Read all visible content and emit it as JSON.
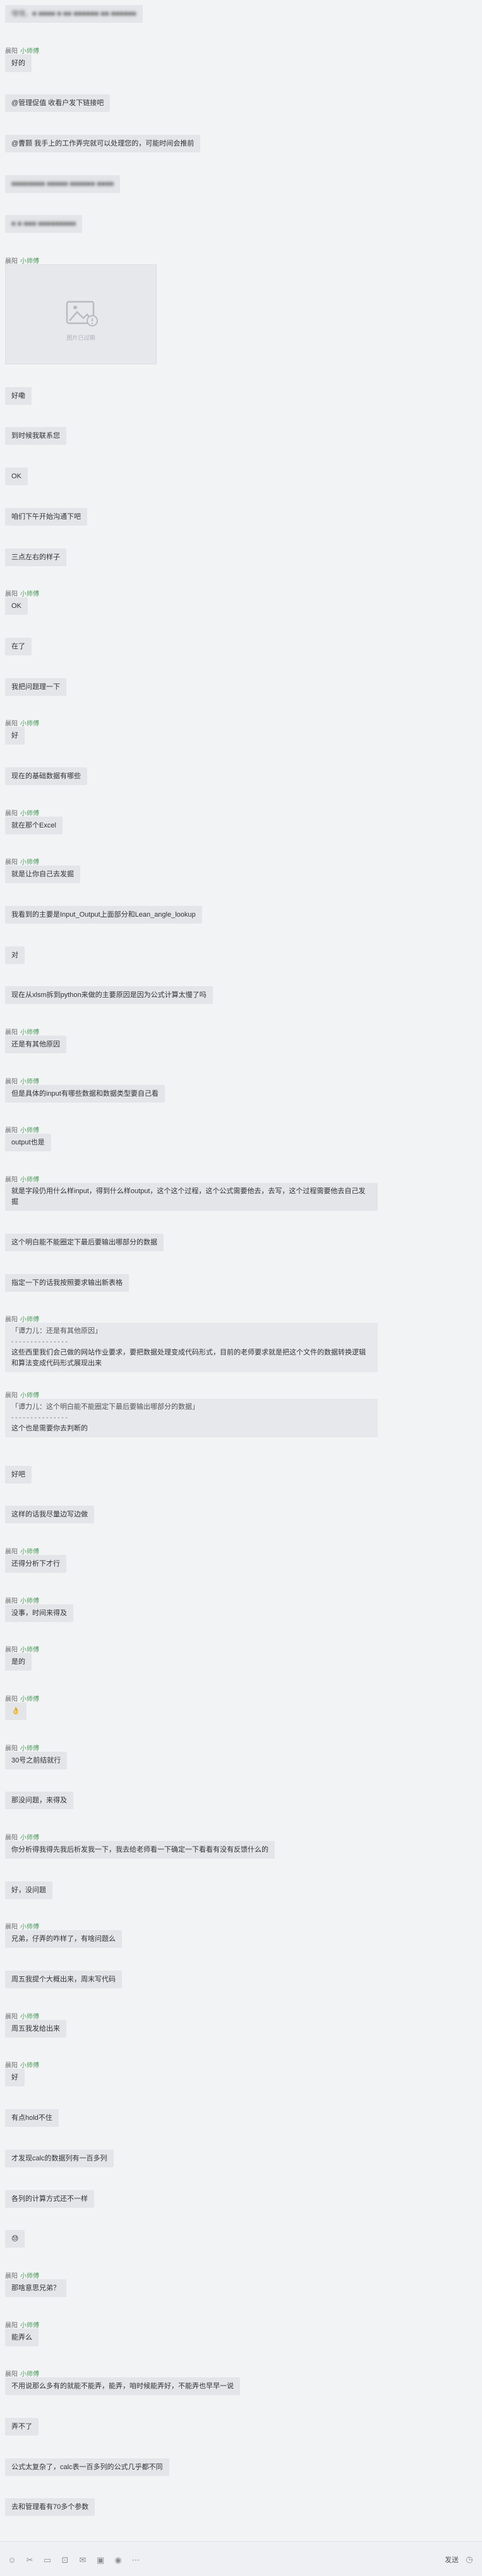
{
  "messages": [
    {
      "type": "text",
      "blurred": true,
      "text": "嘿嘿，■ ■■■■ ■ ■■ ■■■■■■ ■■ ■■■■■■"
    },
    {
      "type": "text",
      "sender": "晨阳",
      "tag": "小师傅",
      "text": "好的"
    },
    {
      "type": "text",
      "text": "@管理促值  收看户发下链接吧"
    },
    {
      "type": "text",
      "text": "@曹颢  我手上的工作弄完就可以处理您的，可能时间会推前"
    },
    {
      "type": "text",
      "blurred": true,
      "text": "■■■■■■■■ ■■■■■ ■■■■■■ ■■■■"
    },
    {
      "type": "text",
      "blurred": true,
      "text": "■ ■ ■■■ ■■■■■■■■■"
    },
    {
      "type": "image",
      "sender": "晨阳",
      "tag": "小师傅",
      "caption": "图片已过期"
    },
    {
      "type": "text",
      "text": "好嘞"
    },
    {
      "type": "text",
      "text": "到时候我联系您"
    },
    {
      "type": "text",
      "text": "OK"
    },
    {
      "type": "text",
      "text": "咱们下午开始沟通下吧"
    },
    {
      "type": "text",
      "text": "三点左右的样子"
    },
    {
      "type": "text",
      "sender": "晨阳",
      "tag": "小师傅",
      "text": "OK"
    },
    {
      "type": "text",
      "text": "在了"
    },
    {
      "type": "text",
      "text": "我把问题理一下"
    },
    {
      "type": "text",
      "sender": "晨阳",
      "tag": "小师傅",
      "text": "好"
    },
    {
      "type": "text",
      "text": "现在的基础数据有哪些"
    },
    {
      "type": "text",
      "sender": "晨阳",
      "tag": "小师傅",
      "text": "就在那个Excel"
    },
    {
      "type": "text",
      "sender": "晨阳",
      "tag": "小师傅",
      "text": "就是让你自己去发掘"
    },
    {
      "type": "text",
      "text": "我看到的主要是Input_Output上面部分和Lean_angle_lookup"
    },
    {
      "type": "text",
      "text": "对"
    },
    {
      "type": "text",
      "text": "现在从xlsm拆到python来做的主要原因是因为公式计算太慢了吗"
    },
    {
      "type": "text",
      "sender": "晨阳",
      "tag": "小师傅",
      "text": "还是有其他原因"
    },
    {
      "type": "text",
      "sender": "晨阳",
      "tag": "小师傅",
      "text": "但是具体的input有哪些数据和数据类型要自己看"
    },
    {
      "type": "text",
      "sender": "晨阳",
      "tag": "小师傅",
      "text": "output也是"
    },
    {
      "type": "text",
      "sender": "晨阳",
      "tag": "小师傅",
      "multiline": true,
      "text": "就是字段仍用什么样input，得到什么样output，这个这个过程，这个公式需要他去，去写，这个过程需要他去自己发掘"
    },
    {
      "type": "text",
      "text": "这个明白能不能圈定下最后要输出哪部分的数据"
    },
    {
      "type": "text",
      "text": "指定一下的话我按照要求输出新表格"
    },
    {
      "type": "quote",
      "sender": "晨阳",
      "tag": "小师傅",
      "quote_text": "「谭力儿：还是有其他原因」",
      "divider": "- - - - - - - - - - - - - - -",
      "text": "这些西里我们会己做的网站作业要求，要把数据处理变成代码形式，目前的老师要求就是把这个文件的数据转换逻辑和算法变成代码形式展现出来"
    },
    {
      "type": "quote",
      "sender": "晨阳",
      "tag": "小师傅",
      "quote_text": "「谭力儿：这个明白能不能圈定下最后要输出哪部分的数据」",
      "divider": "- - - - - - - - - - - - - - -",
      "text": "这个也是需要你去判断的"
    },
    {
      "type": "text",
      "text": "好吧"
    },
    {
      "type": "text",
      "text": "这样的话我尽量边写边做"
    },
    {
      "type": "text",
      "sender": "晨阳",
      "tag": "小师傅",
      "text": "还得分析下才行"
    },
    {
      "type": "text",
      "sender": "晨阳",
      "tag": "小师傅",
      "text": "没事，时间来得及"
    },
    {
      "type": "text",
      "sender": "晨阳",
      "tag": "小师傅",
      "text": "是的"
    },
    {
      "type": "emoji",
      "sender": "晨阳",
      "tag": "小师傅",
      "text": "👌"
    },
    {
      "type": "text",
      "sender": "晨阳",
      "tag": "小师傅",
      "text": "30号之前结就行"
    },
    {
      "type": "text",
      "text": "那没问题，来得及"
    },
    {
      "type": "text",
      "sender": "晨阳",
      "tag": "小师傅",
      "text": "你分析得我得先我后析发我一下，我去给老师看一下确定一下看看有没有反馈什么的"
    },
    {
      "type": "text",
      "text": "好，没问题"
    },
    {
      "type": "text",
      "sender": "晨阳",
      "tag": "小师傅",
      "text": "兄弟，仔弄的咋样了，有啥问题么"
    },
    {
      "type": "text",
      "text": "周五我提个大概出来，周末写代码"
    },
    {
      "type": "text",
      "sender": "晨阳",
      "tag": "小师傅",
      "text": "周五我发给出来"
    },
    {
      "type": "text",
      "sender": "晨阳",
      "tag": "小师傅",
      "text": "好"
    },
    {
      "type": "text",
      "text": "有点hold不住"
    },
    {
      "type": "text",
      "text": "才发现calc的数据列有一百多列"
    },
    {
      "type": "text",
      "text": "各列的计算方式还不一样"
    },
    {
      "type": "emoji",
      "text": "😓"
    },
    {
      "type": "text",
      "sender": "晨阳",
      "tag": "小师傅",
      "text": "那啥意思兄弟？"
    },
    {
      "type": "text",
      "sender": "晨阳",
      "tag": "小师傅",
      "text": "能弄么"
    },
    {
      "type": "text",
      "sender": "晨阳",
      "tag": "小师傅",
      "text": "不用说那么多有的就能不能弄，能弄，咱时候能弄好，不能弄也早早一说"
    },
    {
      "type": "text",
      "text": "弄不了"
    },
    {
      "type": "text",
      "text": "公式太复杂了，calc表一百多列的公式几乎都不同"
    },
    {
      "type": "text",
      "text": "去和管理看有70多个参数"
    }
  ],
  "toolbar": {
    "icons": [
      "emoji-icon",
      "scissors-icon",
      "folder-icon",
      "screenshot-icon",
      "gift-icon",
      "image-icon",
      "mic-icon",
      "more-icon"
    ],
    "send_label": "发送",
    "history_icon": "history-icon"
  }
}
